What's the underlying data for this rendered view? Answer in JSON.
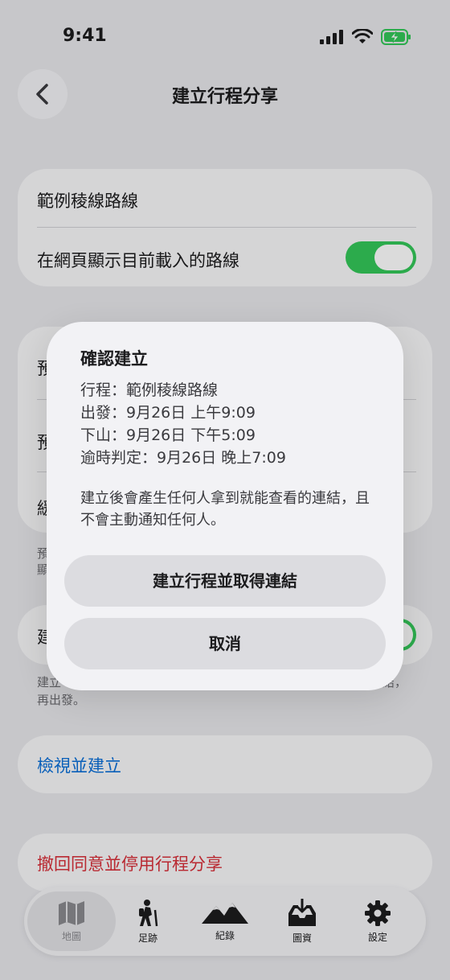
{
  "status": {
    "time": "9:41"
  },
  "nav": {
    "title": "建立行程分享"
  },
  "route_card": {
    "route_name": "範例稜線路線",
    "show_route_label": "在網頁顯示目前載入的路線",
    "show_route_on": true
  },
  "background_obscured": {
    "row1_char": "預",
    "row2_char": "預",
    "row3_char": "緩",
    "note_chars": "預",
    "note_chars2": "顯",
    "row4_char": "建",
    "note_end": "結，",
    "note2": "建立",
    "note2_line2": "再出發。"
  },
  "links": {
    "view_create": "檢視並建立",
    "revoke": "撤回同意並停用行程分享"
  },
  "tabbar": {
    "items": [
      {
        "label": "地圖",
        "icon": "map-icon"
      },
      {
        "label": "足跡",
        "icon": "hiker-icon"
      },
      {
        "label": "紀錄",
        "icon": "mountains-icon"
      },
      {
        "label": "圖資",
        "icon": "download-tray-icon"
      },
      {
        "label": "設定",
        "icon": "gear-icon"
      }
    ]
  },
  "dialog": {
    "title": "確認建立",
    "lines": [
      "行程：範例稜線路線",
      "出發：9月26日 上午9:09",
      "下山：9月26日 下午5:09",
      "逾時判定：9月26日 晚上7:09"
    ],
    "message": "建立後會產生任何人拿到就能查看的連結，且不會主動通知任何人。",
    "confirm_label": "建立行程並取得連結",
    "cancel_label": "取消"
  },
  "colors": {
    "accent_green": "#34c759",
    "link_blue": "#0a6fd8",
    "destructive_red": "#d8303a"
  }
}
